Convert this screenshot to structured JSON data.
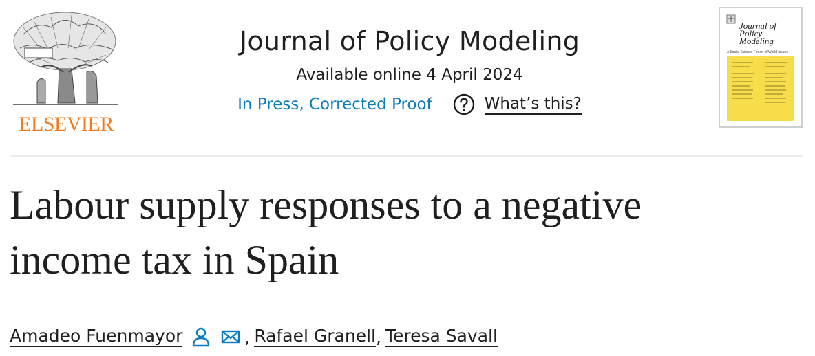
{
  "header": {
    "publisher": "ELSEVIER",
    "journal_title": "Journal of Policy Modeling",
    "available": "Available online 4 April 2024",
    "status_link": "In Press, Corrected Proof",
    "whats_this": "What’s this?",
    "cover": {
      "title_line1": "Journal of",
      "title_line2": "Policy",
      "title_line3": "Modeling",
      "subtitle": "A Social Science Forum of World Issues"
    }
  },
  "article": {
    "title_line1": "Labour supply responses to a negative",
    "title_line2": "income tax in Spain"
  },
  "authors": [
    {
      "name": "Amadeo Fuenmayor"
    },
    {
      "name": "Rafael Granell"
    },
    {
      "name": "Teresa Savall"
    }
  ],
  "punctuation": {
    "comma": ","
  },
  "icons": {
    "question": "question-circle-icon",
    "person": "person-icon",
    "mail": "envelope-icon"
  },
  "colors": {
    "link": "#0c7dbb",
    "publisher_orange": "#f07b1e",
    "cover_yellow": "#f7dd4a"
  }
}
